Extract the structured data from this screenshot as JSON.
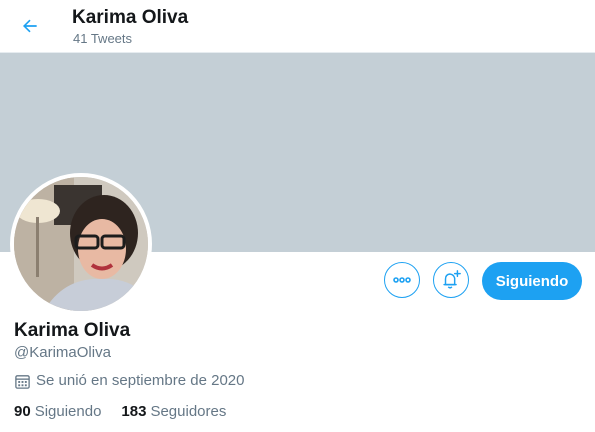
{
  "header": {
    "title": "Karima Oliva",
    "tweet_count": "41 Tweets"
  },
  "profile": {
    "name": "Karima Oliva",
    "handle": "@KarimaOliva",
    "joined": "Se unió en septiembre de 2020",
    "following_count": "90",
    "following_label": "Siguiendo",
    "followers_count": "183",
    "followers_label": "Seguidores"
  },
  "actions": {
    "follow_label": "Siguiendo",
    "more_icon": "more-icon",
    "notify_icon": "bell-plus-icon"
  },
  "colors": {
    "accent": "#1da1f2",
    "banner": "#c4cfd6"
  }
}
